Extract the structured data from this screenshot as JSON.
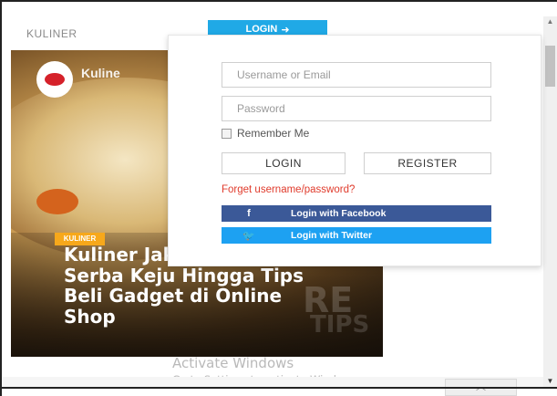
{
  "nav": {
    "title": "KULINER",
    "login_tab_label": "LOGIN",
    "login_tab_icon": "sign-in-icon"
  },
  "hero": {
    "site_name": "Kuline",
    "category_tag": "KULINER",
    "headline": "Kuliner Jakarta, Restoran Serba Keju Hingga Tips Beli Gadget di Online Shop"
  },
  "login_form": {
    "username_placeholder": "Username or Email",
    "password_placeholder": "Password",
    "remember_label": "Remember Me",
    "login_button": "LOGIN",
    "register_button": "REGISTER",
    "forgot_link": "Forget username/password?",
    "facebook_label": "Login with Facebook",
    "facebook_icon": "facebook-icon",
    "twitter_label": "Login with Twitter",
    "twitter_icon": "twitter-icon"
  },
  "watermark": {
    "line1": "Activate Windows",
    "line2": "Go to Settings to activate Windows."
  },
  "colors": {
    "accent": "#20a9e6",
    "facebook": "#3b5998",
    "twitter": "#1da1f2",
    "link": "#e03b2c",
    "tag": "#f7a81b"
  }
}
